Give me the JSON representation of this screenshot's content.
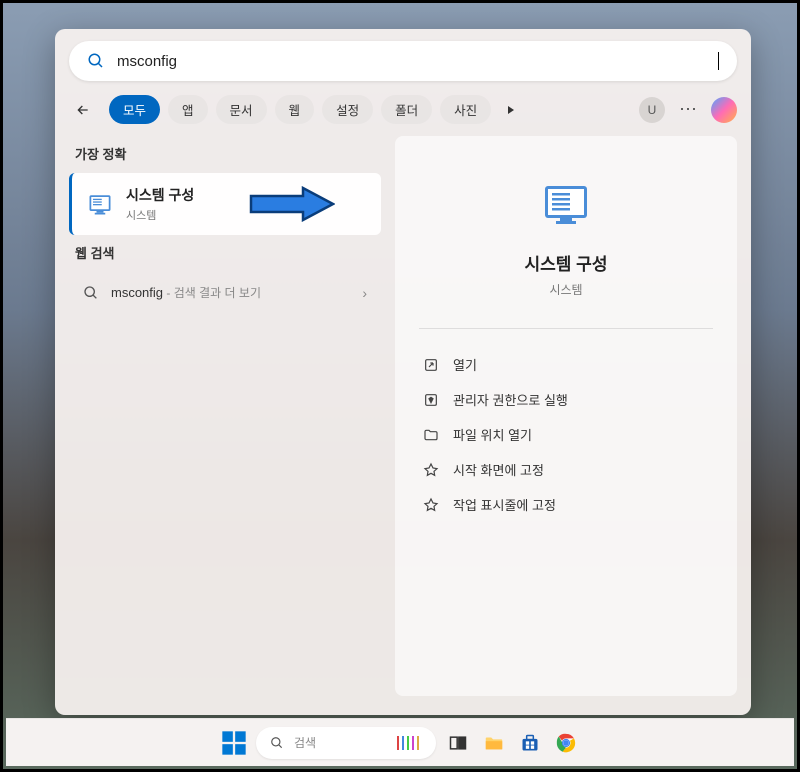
{
  "search": {
    "query": "msconfig"
  },
  "filters": {
    "items": [
      "모두",
      "앱",
      "문서",
      "웹",
      "설정",
      "폴더",
      "사진"
    ],
    "active_index": 0,
    "user_initial": "U"
  },
  "sections": {
    "best_match_label": "가장 정확",
    "web_label": "웹 검색"
  },
  "best_match": {
    "title": "시스템 구성",
    "subtitle": "시스템"
  },
  "web_result": {
    "query": "msconfig",
    "suffix": " - 검색 결과 더 보기"
  },
  "preview": {
    "title": "시스템 구성",
    "subtitle": "시스템",
    "actions": [
      "열기",
      "관리자 권한으로 실행",
      "파일 위치 열기",
      "시작 화면에 고정",
      "작업 표시줄에 고정"
    ]
  },
  "taskbar": {
    "search_placeholder": "검색"
  }
}
